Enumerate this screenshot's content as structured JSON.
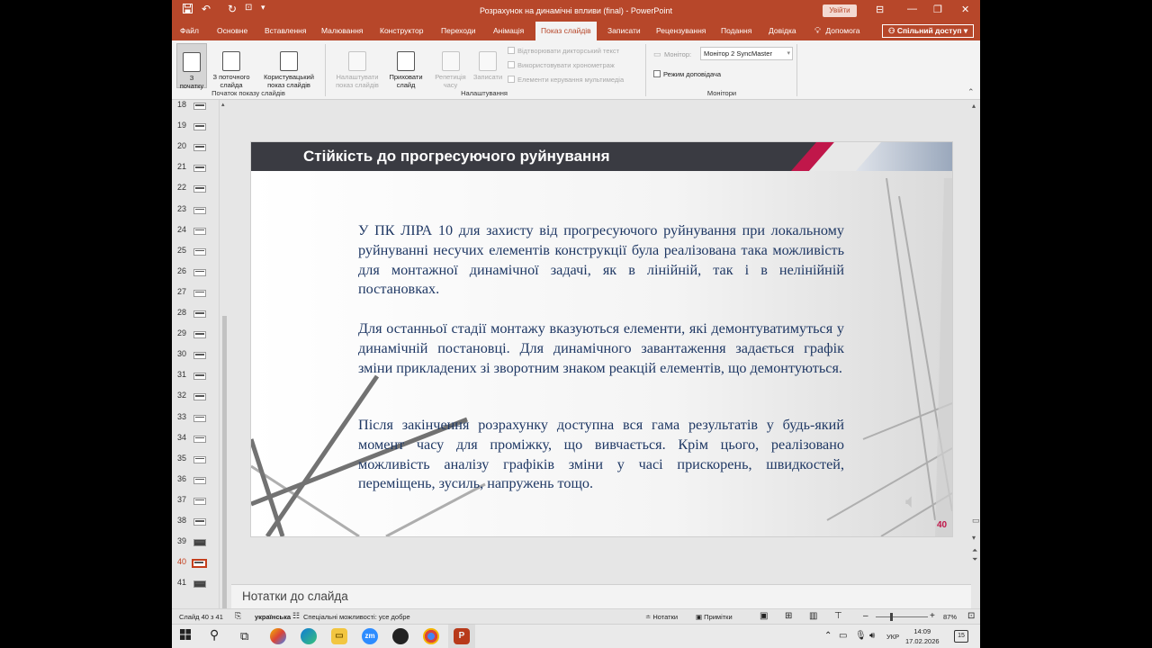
{
  "window": {
    "title": "Розрахунок на динамічні впливи (final)  -  PowerPoint",
    "signin_label": "Увійти"
  },
  "tabs": [
    "Файл",
    "Основне",
    "Вставлення",
    "Малювання",
    "Конструктор",
    "Переходи",
    "Анімація",
    "Показ слайдів",
    "Записати",
    "Рецензування",
    "Подання",
    "Довідка"
  ],
  "help_label": "Допомога",
  "share_label": "Спільний доступ",
  "ribbon": {
    "btn_from_start": "З\nпочатку",
    "btn_from_current": "З поточного\nслайда",
    "btn_custom": "Користувацький\nпоказ слайдів",
    "group_start": "Початок показу слайдів",
    "btn_setup": "Налаштувати\nпоказ слайдів",
    "btn_hide": "Приховати\nслайд",
    "btn_rehearse": "Репетиція\nчасу",
    "btn_record": "Записати",
    "chk_narration": "Відтворювати дикторський текст",
    "chk_timings": "Використовувати хронометраж",
    "chk_media": "Елементи керування мультимедіа",
    "group_setup": "Налаштування",
    "monitor_label": "Монітор:",
    "monitor_value": "Монітор 2 SyncMaster",
    "chk_presenter": "Режим доповідача",
    "group_monitors": "Монітори"
  },
  "thumbs": [
    "18",
    "19",
    "20",
    "21",
    "22",
    "23",
    "24",
    "25",
    "26",
    "27",
    "28",
    "29",
    "30",
    "31",
    "32",
    "33",
    "34",
    "35",
    "36",
    "37",
    "38",
    "39",
    "40",
    "41"
  ],
  "active_slide": "40",
  "slide": {
    "title": "Стійкість до прогресуючого руйнування",
    "para1": "У ПК ЛІРА 10 для захисту від прогресуючого руйнування при локальному руйнуванні несучих елементів конструкції була реалізована така можливість для монтажної динамічної задачі, як в лінійній, так і в нелінійній постановках.",
    "para2": "Для останньої стадії монтажу вказуються елементи, які демонтуватимуться у динамічній постановці. Для динамічного завантаження задається графік зміни прикладених зі зворотним знаком реакцій елементів, що демонтуються.",
    "para3": "Після закінчення розрахунку доступна вся гама результатів у будь-який момент часу для проміжку, що вивчається. Крім цього, реалізовано можливість аналізу графіків зміни у часі прискорень, швидкостей, переміщень, зусиль, напружень тощо.",
    "number": "40"
  },
  "notes_label": "Нотатки до слайда",
  "status": {
    "slide_info": "Слайд 40 з 41",
    "language": "українська",
    "accessibility": "Спеціальні можливості: усе добре",
    "notes_btn": "Нотатки",
    "comments_btn": "Примітки",
    "zoom": "87%"
  },
  "taskbar": {
    "lang": "УКР",
    "time": "14:09",
    "date": "17.02.2026",
    "notif_count": "15"
  },
  "colors": {
    "accent": "#b7472a",
    "slide_text": "#1f3864",
    "slide_bar": "#3a3b42",
    "slide_stripe": "#c0174a"
  }
}
